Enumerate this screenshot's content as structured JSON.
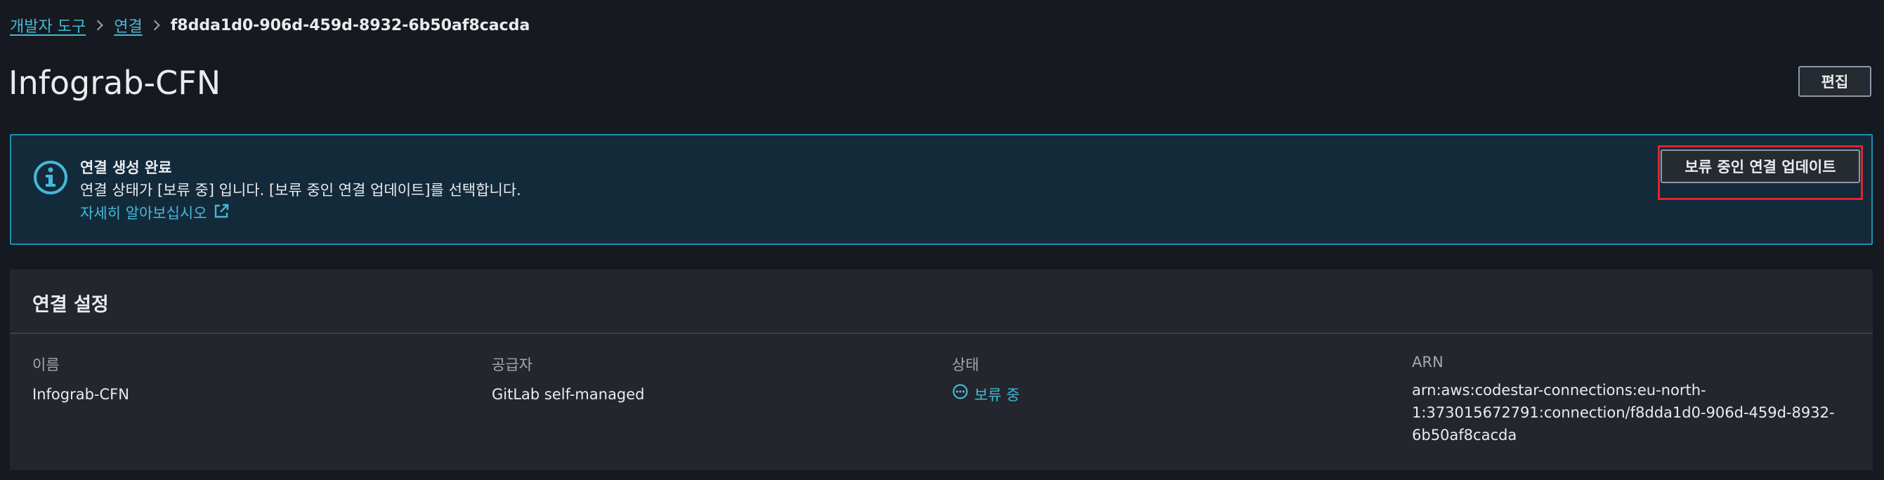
{
  "breadcrumb": {
    "items": [
      {
        "label": "개발자 도구"
      },
      {
        "label": "연결"
      }
    ],
    "current": "f8dda1d0-906d-459d-8932-6b50af8cacda"
  },
  "header": {
    "title": "Infograb-CFN",
    "edit_label": "편집"
  },
  "alert": {
    "icon": "info-icon",
    "title": "연결 생성 완료",
    "body": "연결 상태가 [보류 중] 입니다. [보류 중인 연결 업데이트]를 선택합니다.",
    "link_label": "자세히 알아보십시오",
    "link_icon": "external-link-icon",
    "action_label": "보류 중인 연결 업데이트",
    "highlight_color": "#e0242b"
  },
  "settings": {
    "title": "연결 설정",
    "name_label": "이름",
    "name_value": "Infograb-CFN",
    "provider_label": "공급자",
    "provider_value": "GitLab self-managed",
    "status_label": "상태",
    "status_value": "보류 중",
    "status_icon": "pending-icon",
    "arn_label": "ARN",
    "arn_lines": [
      "arn:aws:codestar-connections:eu-north-",
      "1:373015672791:connection/f8dda1d0-906d-459d-8932-",
      "6b50af8cacda"
    ]
  },
  "colors": {
    "accent": "#44b9d6",
    "background": "#16191f",
    "alert_border": "#1b8fb4"
  }
}
